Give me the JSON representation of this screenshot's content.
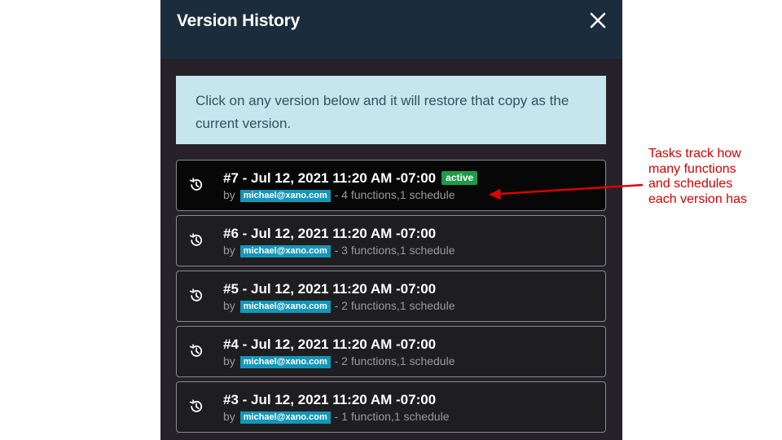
{
  "panel": {
    "title": "Version History",
    "close_icon": "close-x-icon",
    "info_text": "Click on any version below and it will restore that copy as the current version."
  },
  "versions": [
    {
      "title": "#7 - Jul 12, 2021 11:20 AM -07:00",
      "active_label": "active",
      "by": "by",
      "author": "michael@xano.com",
      "summary": "- 4 functions,1 schedule",
      "active": true
    },
    {
      "title": "#6 - Jul 12, 2021 11:20 AM -07:00",
      "by": "by",
      "author": "michael@xano.com",
      "summary": "- 3 functions,1 schedule",
      "active": false
    },
    {
      "title": "#5 - Jul 12, 2021 11:20 AM -07:00",
      "by": "by",
      "author": "michael@xano.com",
      "summary": "- 2 functions,1 schedule",
      "active": false
    },
    {
      "title": "#4 - Jul 12, 2021 11:20 AM -07:00",
      "by": "by",
      "author": "michael@xano.com",
      "summary": "- 2 functions,1 schedule",
      "active": false
    },
    {
      "title": "#3 - Jul 12, 2021 11:20 AM -07:00",
      "by": "by",
      "author": "michael@xano.com",
      "summary": "- 1 function,1 schedule",
      "active": false
    }
  ],
  "annotation": {
    "lines": [
      "Tasks track how",
      "many functions",
      "and schedules",
      "each version has"
    ]
  },
  "colors": {
    "header_bg": "#1b2d3c",
    "panel_bg": "#27212a",
    "info_bg": "#c4e6ec",
    "active_badge": "#1e9b47",
    "author_tag": "#1596b8",
    "annotation": "#d40000"
  }
}
